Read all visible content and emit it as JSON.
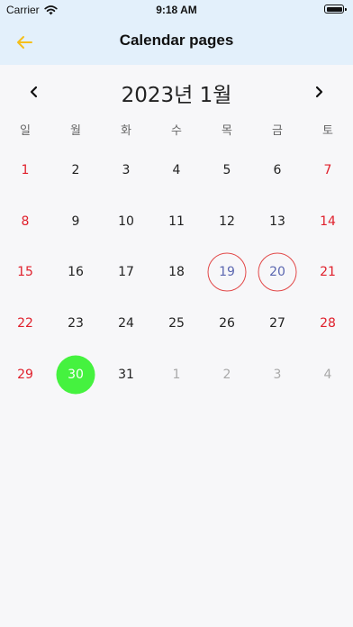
{
  "status_bar": {
    "carrier": "Carrier",
    "time": "9:18 AM"
  },
  "app_bar": {
    "title": "Calendar pages",
    "back_icon": "arrow-left-icon",
    "back_color": "#f5bf1b"
  },
  "calendar": {
    "month_title": "2023년 1월",
    "weekdays": [
      "일",
      "월",
      "화",
      "수",
      "목",
      "금",
      "토"
    ],
    "weekend_color": "#e0202c",
    "outside_month_color": "#a9a9a9",
    "ring_color": "#e24848",
    "ring_text_color": "#5b67b0",
    "today_fill_color": "#45f23f",
    "weeks": [
      [
        {
          "d": "1",
          "type": "weekend"
        },
        {
          "d": "2",
          "type": "normal"
        },
        {
          "d": "3",
          "type": "normal"
        },
        {
          "d": "4",
          "type": "normal"
        },
        {
          "d": "5",
          "type": "normal"
        },
        {
          "d": "6",
          "type": "normal"
        },
        {
          "d": "7",
          "type": "weekend"
        }
      ],
      [
        {
          "d": "8",
          "type": "weekend"
        },
        {
          "d": "9",
          "type": "normal"
        },
        {
          "d": "10",
          "type": "normal"
        },
        {
          "d": "11",
          "type": "normal"
        },
        {
          "d": "12",
          "type": "normal"
        },
        {
          "d": "13",
          "type": "normal"
        },
        {
          "d": "14",
          "type": "weekend"
        }
      ],
      [
        {
          "d": "15",
          "type": "weekend"
        },
        {
          "d": "16",
          "type": "normal"
        },
        {
          "d": "17",
          "type": "normal"
        },
        {
          "d": "18",
          "type": "normal"
        },
        {
          "d": "19",
          "type": "normal",
          "marker": "ring"
        },
        {
          "d": "20",
          "type": "normal",
          "marker": "ring"
        },
        {
          "d": "21",
          "type": "weekend"
        }
      ],
      [
        {
          "d": "22",
          "type": "weekend"
        },
        {
          "d": "23",
          "type": "normal"
        },
        {
          "d": "24",
          "type": "normal"
        },
        {
          "d": "25",
          "type": "normal"
        },
        {
          "d": "26",
          "type": "normal"
        },
        {
          "d": "27",
          "type": "normal"
        },
        {
          "d": "28",
          "type": "weekend"
        }
      ],
      [
        {
          "d": "29",
          "type": "weekend"
        },
        {
          "d": "30",
          "type": "normal",
          "marker": "fill"
        },
        {
          "d": "31",
          "type": "normal"
        },
        {
          "d": "1",
          "type": "outside"
        },
        {
          "d": "2",
          "type": "outside"
        },
        {
          "d": "3",
          "type": "outside"
        },
        {
          "d": "4",
          "type": "outside"
        }
      ]
    ]
  }
}
